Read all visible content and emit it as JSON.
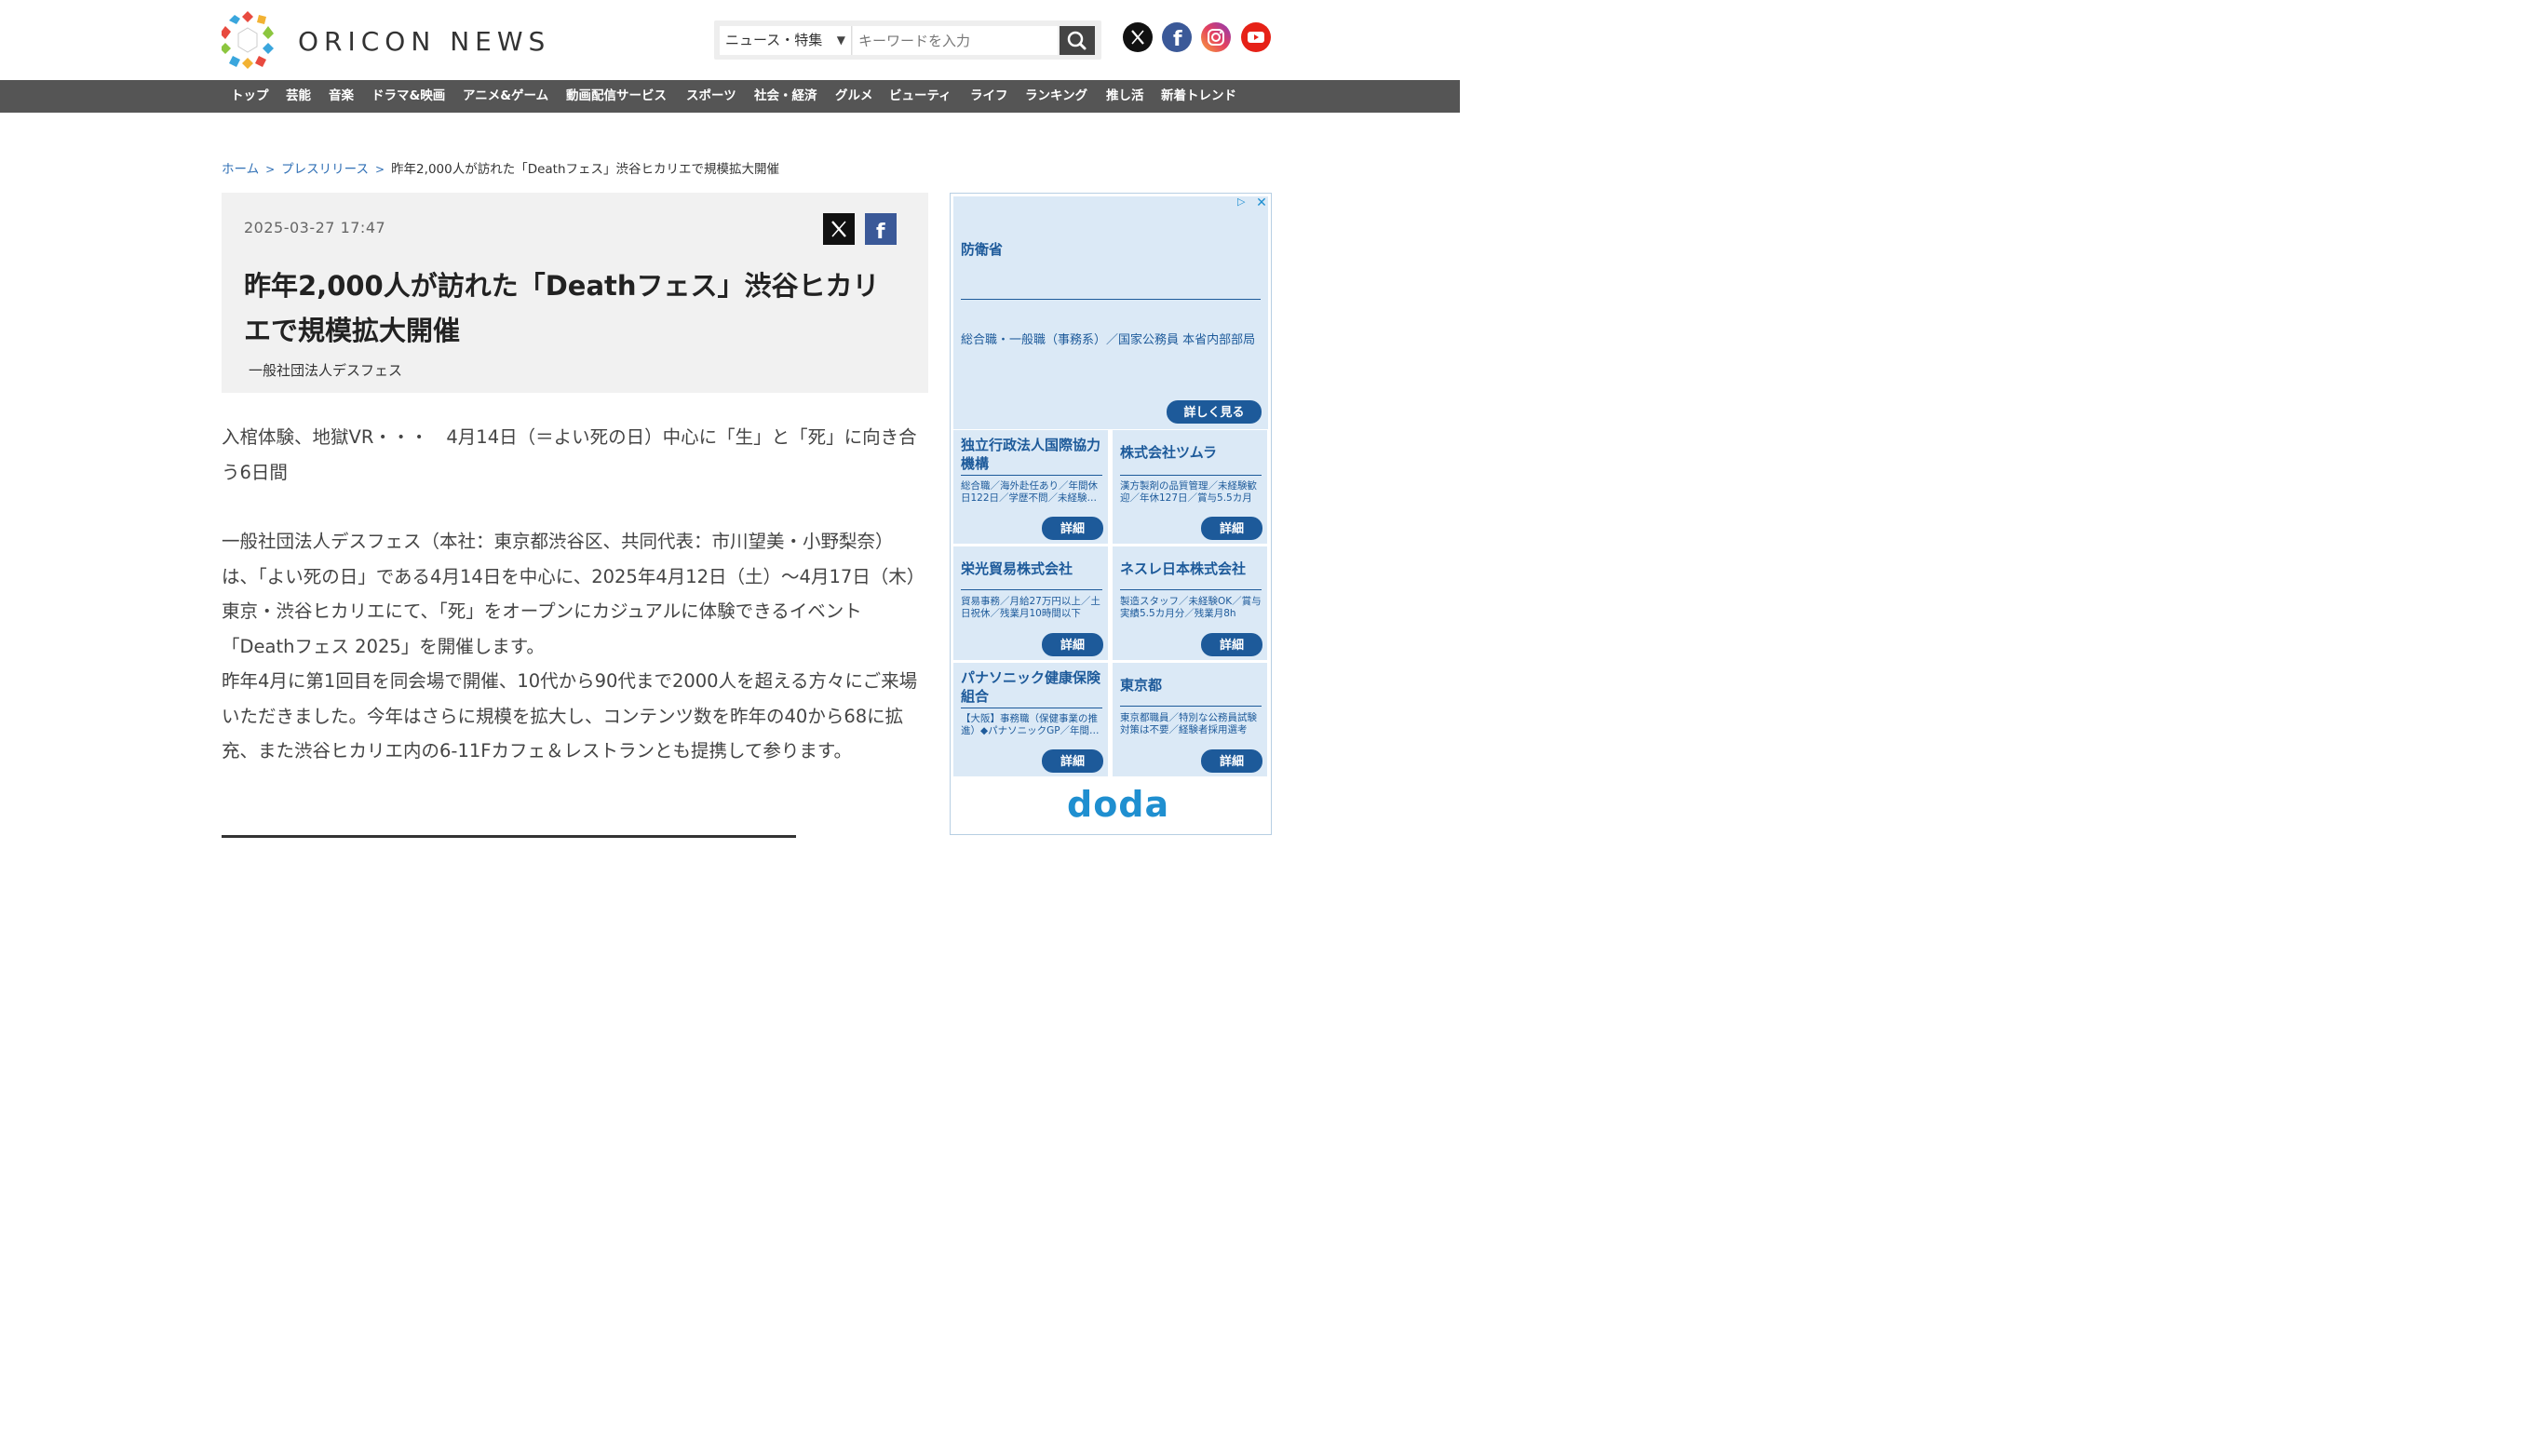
{
  "brand": {
    "name": "ORICON NEWS",
    "logo_icon": "oricon-hexagon-logo"
  },
  "search": {
    "category": "ニュース・特集",
    "placeholder": "キーワードを入力",
    "icon": "search-icon"
  },
  "social": [
    {
      "name": "x",
      "color": "#111111"
    },
    {
      "name": "facebook",
      "color": "#3b5998"
    },
    {
      "name": "instagram",
      "color": "#e4405f"
    },
    {
      "name": "youtube",
      "color": "#e62117"
    }
  ],
  "nav": {
    "items": [
      {
        "label": "トップ"
      },
      {
        "label": "芸能"
      },
      {
        "label": "音楽"
      },
      {
        "label": "ドラマ&映画"
      },
      {
        "label": "アニメ&ゲーム"
      },
      {
        "label": "動画配信サービス"
      },
      {
        "label": "スポーツ"
      },
      {
        "label": "社会・経済"
      },
      {
        "label": "グルメ"
      },
      {
        "label": "ビューティ"
      },
      {
        "label": "ライフ"
      },
      {
        "label": "ランキング"
      },
      {
        "label": "推し活"
      },
      {
        "label": "新着トレンド"
      }
    ]
  },
  "breadcrumb": {
    "home": "ホーム",
    "section": "プレスリリース",
    "current": "昨年2,000人が訪れた「Deathフェス」渋谷ヒカリエで規模拡大開催"
  },
  "article": {
    "date": "2025-03-27 17:47",
    "title": "昨年2,000人が訪れた「Deathフェス」渋谷ヒカリエで規模拡大開催",
    "author": "一般社団法人デスフェス",
    "paragraphs": [
      "入棺体験、地獄VR・・・　4月14日（＝よい死の日）中心に「生」と「死」に向き合う6日間",
      "一般社団法人デスフェス（本社：東京都渋谷区、共同代表：市川望美・小野梨奈）は、「よい死の日」である4月14日を中心に、2025年4月12日（土）～4月17日（木）東京・渋谷ヒカリエにて、「死」をオープンにカジュアルに体験できるイベント「Deathフェス 2025」を開催します。",
      "昨年4月に第1回目を同会場で開催、10代から90代まで2000人を超える方々にご来場いただきました。今年はさらに規模を拡大し、コンテンツ数を昨年の40から68に拡充、また渋谷ヒカリエ内の6-11Fカフェ＆レストランとも提携して参ります。"
    ]
  },
  "ad": {
    "choice_label": "▷",
    "close_label": "✕",
    "top": {
      "title": "防衛省",
      "desc": "総合職・一般職（事務系）／国家公務員 本省内部部局",
      "button": "詳しく見る"
    },
    "cells": [
      {
        "title": "独立行政法人国際協力機構",
        "desc": "総合職／海外赴任あり／年間休日122日／学歴不問／未経験…",
        "button": "詳細"
      },
      {
        "title": "株式会社ツムラ",
        "desc": "漢方製剤の品質管理／未経験歓迎／年休127日／賞与5.5カ月",
        "button": "詳細"
      },
      {
        "title": "栄光貿易株式会社",
        "desc": "貿易事務／月給27万円以上／土日祝休／残業月10時間以下",
        "button": "詳細"
      },
      {
        "title": "ネスレ日本株式会社",
        "desc": "製造スタッフ／未経験OK／賞与実績5.5カ月分／残業月8h",
        "button": "詳細"
      },
      {
        "title": "パナソニック健康保険組合",
        "desc": "【大阪】事務職（保健事業の推進）◆パナソニックGP／年間…",
        "button": "詳細"
      },
      {
        "title": "東京都",
        "desc": "東京都職員／特別な公務員試験対策は不要／経験者採用選考",
        "button": "詳細"
      }
    ],
    "footer_brand": "doda"
  }
}
